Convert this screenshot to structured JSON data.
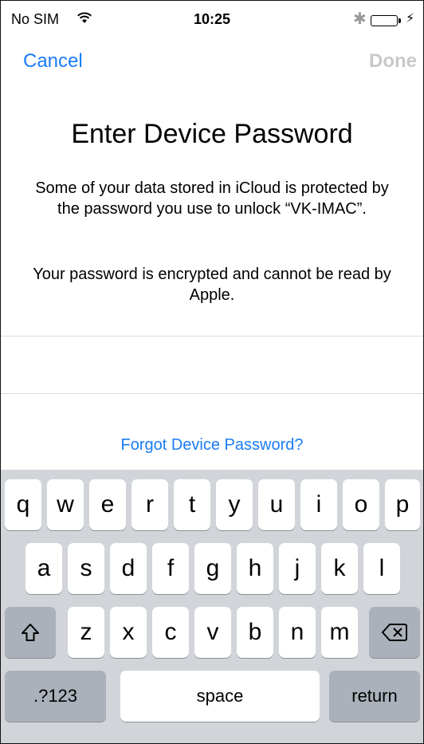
{
  "status_bar": {
    "carrier": "No SIM",
    "wifi_icon": "wifi-icon",
    "time": "10:25",
    "bluetooth_icon": "bluetooth-icon",
    "battery_icon": "battery-charging-icon"
  },
  "nav": {
    "cancel": "Cancel",
    "done": "Done"
  },
  "content": {
    "title": "Enter Device Password",
    "description": "Some of your data stored in iCloud is protected by the password you use to unlock “VK-IMAC”.",
    "note": "Your password is encrypted and cannot be read by Apple.",
    "password_value": "",
    "forgot_link": "Forgot Device Password?"
  },
  "keyboard": {
    "row1": [
      "q",
      "w",
      "e",
      "r",
      "t",
      "y",
      "u",
      "i",
      "o",
      "p"
    ],
    "row2": [
      "a",
      "s",
      "d",
      "f",
      "g",
      "h",
      "j",
      "k",
      "l"
    ],
    "row3": [
      "z",
      "x",
      "c",
      "v",
      "b",
      "n",
      "m"
    ],
    "shift_icon": "shift-icon",
    "delete_icon": "delete-icon",
    "numbers_key": ".?123",
    "space_key": "space",
    "return_key": "return"
  },
  "colors": {
    "accent": "#1b7cf4",
    "disabled": "#c8c8c8",
    "keyboard_bg": "#d1d4d9",
    "function_key": "#abb1ba"
  }
}
